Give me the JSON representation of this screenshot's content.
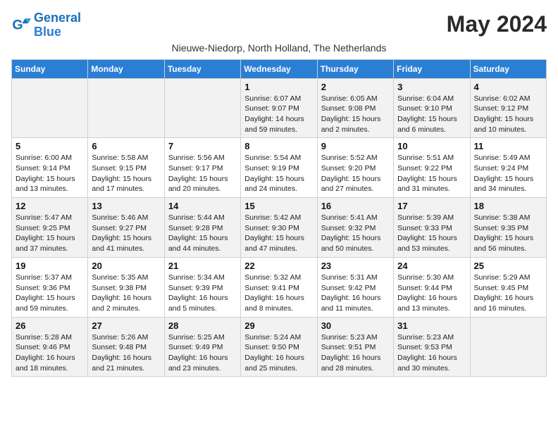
{
  "header": {
    "logo_line1": "General",
    "logo_line2": "Blue",
    "month_title": "May 2024",
    "subtitle": "Nieuwe-Niedorp, North Holland, The Netherlands"
  },
  "weekdays": [
    "Sunday",
    "Monday",
    "Tuesday",
    "Wednesday",
    "Thursday",
    "Friday",
    "Saturday"
  ],
  "weeks": [
    [
      {
        "day": "",
        "info": ""
      },
      {
        "day": "",
        "info": ""
      },
      {
        "day": "",
        "info": ""
      },
      {
        "day": "1",
        "info": "Sunrise: 6:07 AM\nSunset: 9:07 PM\nDaylight: 14 hours\nand 59 minutes."
      },
      {
        "day": "2",
        "info": "Sunrise: 6:05 AM\nSunset: 9:08 PM\nDaylight: 15 hours\nand 2 minutes."
      },
      {
        "day": "3",
        "info": "Sunrise: 6:04 AM\nSunset: 9:10 PM\nDaylight: 15 hours\nand 6 minutes."
      },
      {
        "day": "4",
        "info": "Sunrise: 6:02 AM\nSunset: 9:12 PM\nDaylight: 15 hours\nand 10 minutes."
      }
    ],
    [
      {
        "day": "5",
        "info": "Sunrise: 6:00 AM\nSunset: 9:14 PM\nDaylight: 15 hours\nand 13 minutes."
      },
      {
        "day": "6",
        "info": "Sunrise: 5:58 AM\nSunset: 9:15 PM\nDaylight: 15 hours\nand 17 minutes."
      },
      {
        "day": "7",
        "info": "Sunrise: 5:56 AM\nSunset: 9:17 PM\nDaylight: 15 hours\nand 20 minutes."
      },
      {
        "day": "8",
        "info": "Sunrise: 5:54 AM\nSunset: 9:19 PM\nDaylight: 15 hours\nand 24 minutes."
      },
      {
        "day": "9",
        "info": "Sunrise: 5:52 AM\nSunset: 9:20 PM\nDaylight: 15 hours\nand 27 minutes."
      },
      {
        "day": "10",
        "info": "Sunrise: 5:51 AM\nSunset: 9:22 PM\nDaylight: 15 hours\nand 31 minutes."
      },
      {
        "day": "11",
        "info": "Sunrise: 5:49 AM\nSunset: 9:24 PM\nDaylight: 15 hours\nand 34 minutes."
      }
    ],
    [
      {
        "day": "12",
        "info": "Sunrise: 5:47 AM\nSunset: 9:25 PM\nDaylight: 15 hours\nand 37 minutes."
      },
      {
        "day": "13",
        "info": "Sunrise: 5:46 AM\nSunset: 9:27 PM\nDaylight: 15 hours\nand 41 minutes."
      },
      {
        "day": "14",
        "info": "Sunrise: 5:44 AM\nSunset: 9:28 PM\nDaylight: 15 hours\nand 44 minutes."
      },
      {
        "day": "15",
        "info": "Sunrise: 5:42 AM\nSunset: 9:30 PM\nDaylight: 15 hours\nand 47 minutes."
      },
      {
        "day": "16",
        "info": "Sunrise: 5:41 AM\nSunset: 9:32 PM\nDaylight: 15 hours\nand 50 minutes."
      },
      {
        "day": "17",
        "info": "Sunrise: 5:39 AM\nSunset: 9:33 PM\nDaylight: 15 hours\nand 53 minutes."
      },
      {
        "day": "18",
        "info": "Sunrise: 5:38 AM\nSunset: 9:35 PM\nDaylight: 15 hours\nand 56 minutes."
      }
    ],
    [
      {
        "day": "19",
        "info": "Sunrise: 5:37 AM\nSunset: 9:36 PM\nDaylight: 15 hours\nand 59 minutes."
      },
      {
        "day": "20",
        "info": "Sunrise: 5:35 AM\nSunset: 9:38 PM\nDaylight: 16 hours\nand 2 minutes."
      },
      {
        "day": "21",
        "info": "Sunrise: 5:34 AM\nSunset: 9:39 PM\nDaylight: 16 hours\nand 5 minutes."
      },
      {
        "day": "22",
        "info": "Sunrise: 5:32 AM\nSunset: 9:41 PM\nDaylight: 16 hours\nand 8 minutes."
      },
      {
        "day": "23",
        "info": "Sunrise: 5:31 AM\nSunset: 9:42 PM\nDaylight: 16 hours\nand 11 minutes."
      },
      {
        "day": "24",
        "info": "Sunrise: 5:30 AM\nSunset: 9:44 PM\nDaylight: 16 hours\nand 13 minutes."
      },
      {
        "day": "25",
        "info": "Sunrise: 5:29 AM\nSunset: 9:45 PM\nDaylight: 16 hours\nand 16 minutes."
      }
    ],
    [
      {
        "day": "26",
        "info": "Sunrise: 5:28 AM\nSunset: 9:46 PM\nDaylight: 16 hours\nand 18 minutes."
      },
      {
        "day": "27",
        "info": "Sunrise: 5:26 AM\nSunset: 9:48 PM\nDaylight: 16 hours\nand 21 minutes."
      },
      {
        "day": "28",
        "info": "Sunrise: 5:25 AM\nSunset: 9:49 PM\nDaylight: 16 hours\nand 23 minutes."
      },
      {
        "day": "29",
        "info": "Sunrise: 5:24 AM\nSunset: 9:50 PM\nDaylight: 16 hours\nand 25 minutes."
      },
      {
        "day": "30",
        "info": "Sunrise: 5:23 AM\nSunset: 9:51 PM\nDaylight: 16 hours\nand 28 minutes."
      },
      {
        "day": "31",
        "info": "Sunrise: 5:23 AM\nSunset: 9:53 PM\nDaylight: 16 hours\nand 30 minutes."
      },
      {
        "day": "",
        "info": ""
      }
    ]
  ]
}
